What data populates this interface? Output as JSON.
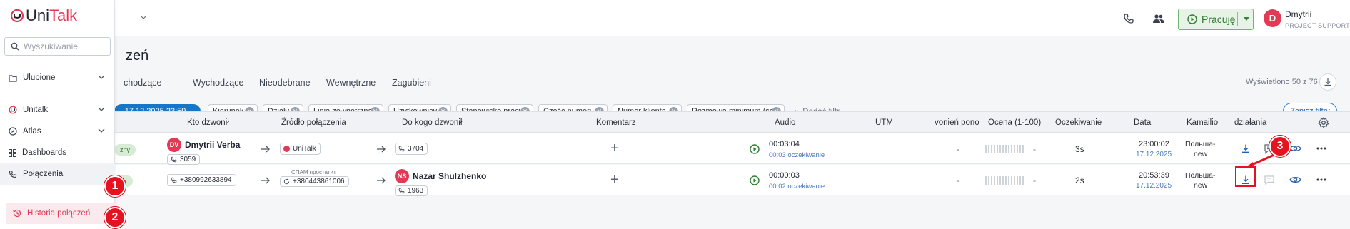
{
  "app": {
    "brand_left": "Uni",
    "brand_right": "Talk",
    "brand_color": "#e23a55"
  },
  "header": {
    "status_label": "Pracuję",
    "status_color": "#2e7d32",
    "user_initial": "D",
    "user_name": "Dmytrii",
    "user_role": "PROJECT-SUPPORT",
    "icons": [
      "phone-icon",
      "team-icon",
      "play-icon",
      "chevron-down-icon"
    ]
  },
  "sidebar": {
    "search_placeholder": "Wyszukiwanie",
    "items": [
      {
        "label": "Ulubione",
        "icon": "folder-icon",
        "expandable": true
      },
      {
        "label": "Unitalk",
        "icon": "unitalk-logo-icon",
        "expandable": true
      },
      {
        "label": "Atlas",
        "icon": "compass-icon",
        "expandable": true
      },
      {
        "label": "Dashboards",
        "icon": "grid-icon",
        "expandable": false
      },
      {
        "label": "Połączenia",
        "icon": "phone-icon",
        "expandable": false
      },
      {
        "label": "Historia połączeń",
        "icon": "history-icon",
        "expandable": false
      }
    ]
  },
  "page": {
    "title": "zeń",
    "tabs": [
      "chodzące",
      "Wychodzące",
      "Nieodebrane",
      "Wewnętrzne",
      "Zagubieni"
    ],
    "shown_count": "Wyświetlono 50 z 76"
  },
  "filters": {
    "date_range": "- 17.12.2025 23:59",
    "chips": [
      "Kierunek",
      "Działy",
      "Linia zewnętrzna",
      "Użytkownicy",
      "Stanowisko pracy",
      "Część numeru",
      "Numer klienta",
      "Rozmowa minimum (sek)"
    ],
    "add_label": "Dodać filtr",
    "save_label": "Zapisz filtry"
  },
  "table": {
    "columns": [
      "Kto dzwonił",
      "Źródło połączenia",
      "Do kogo dzwonił",
      "Komentarz",
      "Audio",
      "UTM",
      "vonień pono",
      "Ocena (1-100)",
      "Oczekiwanie",
      "Data",
      "Kamailio",
      "działania"
    ],
    "rows": [
      {
        "status": "zny",
        "caller_initials": "DV",
        "caller_name": "Dmytrii Verba",
        "caller_ext": "3059",
        "source": "UniTalk",
        "source_sub": "",
        "callee_initials": "",
        "callee_name": "",
        "callee_ext": "3704",
        "duration": "00:03:04",
        "wait_text": "00:03 oczekiwanie",
        "utm_dash": "-",
        "rating_dash": "-",
        "waiting": "3s",
        "time": "23:00:02",
        "date": "17.12.2025",
        "kamailio_1": "Польша-",
        "kamailio_2": "new"
      },
      {
        "status": "dz...",
        "caller_initials": "",
        "caller_name": "",
        "caller_ext": "+380992633894",
        "source": "+380443861006",
        "source_sub": "СПАМ простатит",
        "callee_initials": "NS",
        "callee_name": "Nazar Shulzhenko",
        "callee_ext": "1963",
        "duration": "00:00:03",
        "wait_text": "00:02 oczekiwanie",
        "utm_dash": "-",
        "rating_dash": "-",
        "waiting": "2s",
        "time": "20:53:39",
        "date": "17.12.2025",
        "kamailio_1": "Польша-",
        "kamailio_2": "new"
      }
    ]
  },
  "annotations": [
    "1",
    "2",
    "3"
  ],
  "annotation_color": "#e4131f",
  "accent_color": "#1677c8"
}
